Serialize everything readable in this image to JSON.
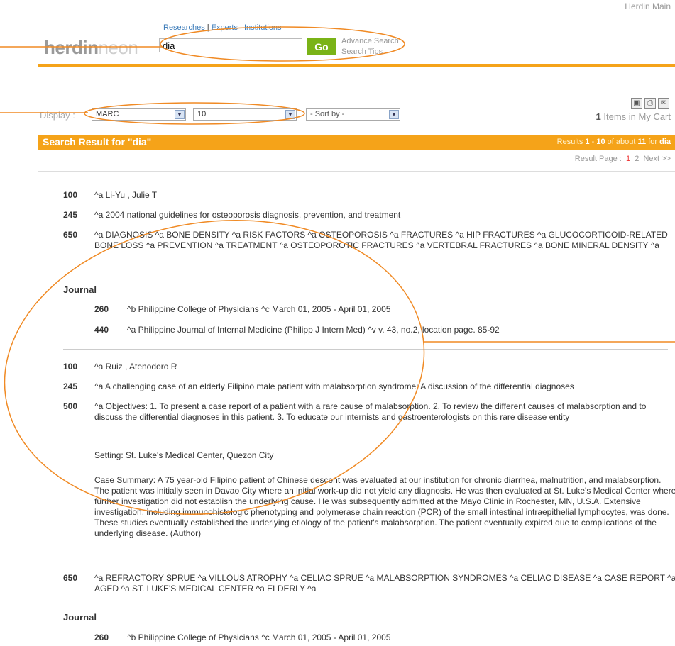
{
  "header": {
    "app_link": "Herdin Main"
  },
  "logo": {
    "part1": "herdin",
    "part2": "neon"
  },
  "top_links": [
    "Researches",
    "Experts",
    "Institutions"
  ],
  "search": {
    "value": "dia",
    "go": "Go",
    "advance": "Advance Search",
    "tips": "Search Tips"
  },
  "toolbar_icons": [
    "save-icon",
    "print-icon",
    "email-icon"
  ],
  "display": {
    "label": "Display :",
    "format": "MARC",
    "count": "10",
    "sort": "- Sort by -"
  },
  "cart": {
    "count": "1",
    "label": "Items in My Cart"
  },
  "result_bar": {
    "title": "Search Result for  \"dia\"",
    "pre": "Results",
    "from": "1",
    "dash": "-",
    "to": "10",
    "of": "of about",
    "total": "11",
    "for": "for",
    "term": "dia"
  },
  "pager": {
    "label": "Result Page :",
    "pages": [
      "1",
      "2"
    ],
    "next": "Next >>"
  },
  "journal_heading": "Journal",
  "records": [
    {
      "fields": [
        {
          "tag": "100",
          "text": "^a Li-Yu , Julie T"
        },
        {
          "tag": "245",
          "text": "^a 2004 national guidelines for osteoporosis diagnosis, prevention, and treatment"
        },
        {
          "tag": "650",
          "text": "^a DIAGNOSIS ^a BONE DENSITY ^a RISK FACTORS ^a OSTEOPOROSIS ^a FRACTURES ^a HIP FRACTURES ^a GLUCOCORTICOID-RELATED BONE LOSS ^a PREVENTION ^a TREATMENT ^a OSTEOPOROTIC FRACTURES ^a VERTEBRAL FRACTURES ^a BONE MINERAL DENSITY ^a"
        }
      ],
      "journal": [
        {
          "tag": "260",
          "text": "^b Philippine College of Physicians ^c March 01, 2005 - April 01, 2005"
        },
        {
          "tag": "440",
          "text": "^a Philippine Journal of Internal Medicine (Philipp J Intern Med) ^v v. 43, no.2, location page. 85-92"
        }
      ]
    },
    {
      "fields": [
        {
          "tag": "100",
          "text": "^a Ruiz , Atenodoro R"
        },
        {
          "tag": "245",
          "text": "^a A challenging case of an elderly Filipino male patient with malabsorption syndrome: A discussion of the differential diagnoses"
        },
        {
          "tag": "500",
          "text": "^a Objectives: 1. To present a case report of a patient with a rare cause of malabsorption. 2. To review the different causes of malabsorption and to discuss the differential diagnoses in this patient. 3. To educate our internists and gastroenterologists on this rare disease entity"
        },
        {
          "tag": "",
          "text": "Setting: St. Luke's Medical Center, Quezon City"
        },
        {
          "tag": "",
          "text": "Case Summary: A 75 year-old Filipino patient of Chinese descent was evaluated at our institution for chronic diarrhea, malnutrition, and malabsorption. The patient was initially seen in Davao City where an initial work-up did not yield any diagnosis. He was then evaluated at St. Luke's Medical Center where further investigation did not establish the underlying cause. He was subsequently admitted at the Mayo Clinic in Rochester, MN, U.S.A. Extensive investigation, including immunohistologic phenotyping and polymerase chain reaction (PCR) of the small intestinal intraepithelial lymphocytes, was done. These studies eventually established the underlying etiology of the patient's malabsorption. The patient eventually expired due to complications of the underlying disease. (Author)"
        },
        {
          "tag": "650",
          "text": "^a REFRACTORY SPRUE ^a VILLOUS ATROPHY ^a CELIAC SPRUE ^a MALABSORPTION SYNDROMES ^a CELIAC DISEASE ^a CASE REPORT ^a AGED ^a ST. LUKE'S MEDICAL CENTER ^a ELDERLY ^a"
        }
      ],
      "journal": [
        {
          "tag": "260",
          "text": "^b Philippine College of Physicians ^c March 01, 2005 - April 01, 2005"
        }
      ]
    }
  ],
  "colors": {
    "accent": "#f5a319",
    "go": "#7ab317",
    "link": "#3a7ab8",
    "annotation": "#f08a24"
  }
}
